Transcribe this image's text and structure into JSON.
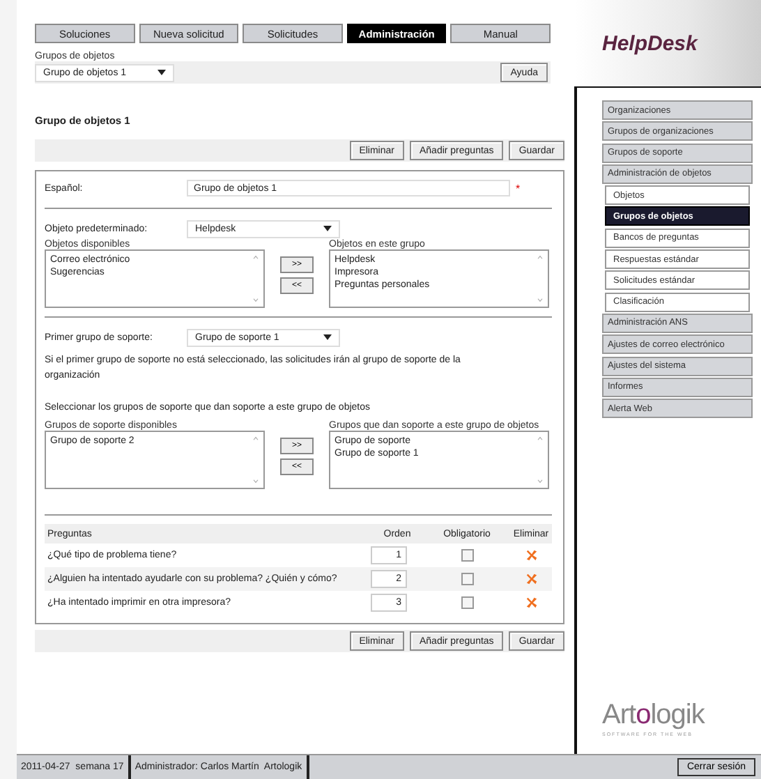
{
  "nav_tabs": [
    {
      "label": "Soluciones",
      "selected": false
    },
    {
      "label": "Nueva solicitud",
      "selected": false
    },
    {
      "label": "Solicitudes",
      "selected": false
    },
    {
      "label": "Administración",
      "selected": true
    },
    {
      "label": "Manual",
      "selected": false
    }
  ],
  "group_select": {
    "label": "Grupos de objetos",
    "value": "Grupo de objetos 1"
  },
  "help_button": "Ayuda",
  "logo": "HelpDesk",
  "heading": "Grupo de objetos 1",
  "actions": [
    "Eliminar",
    "Añadir preguntas",
    "Guardar"
  ],
  "form": {
    "name": {
      "label": "Español:",
      "value": "Grupo de objetos 1",
      "required_mark": "*"
    },
    "default_object": {
      "label": "Objeto predeterminado:",
      "value": "Helpdesk"
    },
    "objects": {
      "available_label": "Objetos disponibles",
      "available": [
        {
          "label": "Correo electrónico",
          "selected": false
        },
        {
          "label": "Sugerencias",
          "selected": false
        }
      ],
      "add": ">>",
      "remove": "<<",
      "assigned_label": "Objetos en este grupo",
      "assigned": [
        {
          "label": "Helpdesk",
          "selected": false
        },
        {
          "label": "Impresora",
          "selected": false
        },
        {
          "label": "Preguntas personales",
          "selected": false
        }
      ]
    },
    "first_support": {
      "label": "Primer grupo de soporte:",
      "value": "Grupo de soporte 1",
      "note": "Si el primer grupo de soporte no está seleccionado, las solicitudes irán al grupo de soporte de la organización"
    },
    "support_intro": "Seleccionar los grupos de soporte que dan soporte a este grupo de objetos",
    "support": {
      "available_label": "Grupos de soporte disponibles",
      "available": [
        {
          "label": "Grupo de soporte 2",
          "selected": false
        }
      ],
      "add": ">>",
      "remove": "<<",
      "assigned_label": "Grupos que dan soporte a este grupo de objetos",
      "assigned": [
        {
          "label": "Grupo de soporte",
          "selected": false
        },
        {
          "label": "Grupo de soporte 1",
          "selected": false
        }
      ]
    },
    "questions": {
      "columns": [
        "Preguntas",
        "Orden",
        "Obligatorio",
        "Eliminar"
      ],
      "rows": [
        {
          "text": "¿Qué tipo de problema tiene?",
          "order": "1",
          "mandatory": false
        },
        {
          "text": "¿Alguien ha intentado ayudarle con su problema? ¿Quién y cómo?",
          "order": "2",
          "mandatory": false
        },
        {
          "text": "¿Ha intentado imprimir en otra impresora?",
          "order": "3",
          "mandatory": false
        }
      ]
    }
  },
  "bottom_actions": [
    "Eliminar",
    "Añadir preguntas",
    "Guardar"
  ],
  "sidebar": {
    "items": [
      {
        "label": "Organizaciones",
        "selected": false
      },
      {
        "label": "Grupos de organizaciones",
        "selected": false
      },
      {
        "label": "Grupos de soporte",
        "selected": false
      },
      {
        "label": "Administración de objetos",
        "selected": false,
        "children": [
          {
            "label": "Objetos",
            "selected": false
          },
          {
            "label": "Grupos de objetos",
            "selected": true
          },
          {
            "label": "Bancos de preguntas",
            "selected": false
          },
          {
            "label": "Respuestas estándar",
            "selected": false
          },
          {
            "label": "Solicitudes estándar",
            "selected": false
          },
          {
            "label": "Clasificación",
            "selected": false
          }
        ]
      },
      {
        "label": "Administración ANS",
        "selected": false
      },
      {
        "label": "Ajustes de correo electrónico",
        "selected": false
      },
      {
        "label": "Ajustes del sistema",
        "selected": false
      },
      {
        "label": "Informes",
        "selected": false
      },
      {
        "label": "Alerta Web",
        "selected": false
      }
    ]
  },
  "brand": {
    "name_start": "Art",
    "name_accent": "o",
    "name_end": "logik",
    "tagline": "SOFTWARE FOR THE WEB"
  },
  "status_bar": {
    "date": "2011-04-27  semana 17",
    "user": "Administrador: Carlos Martín  Artologik",
    "logout": "Cerrar sesión"
  }
}
